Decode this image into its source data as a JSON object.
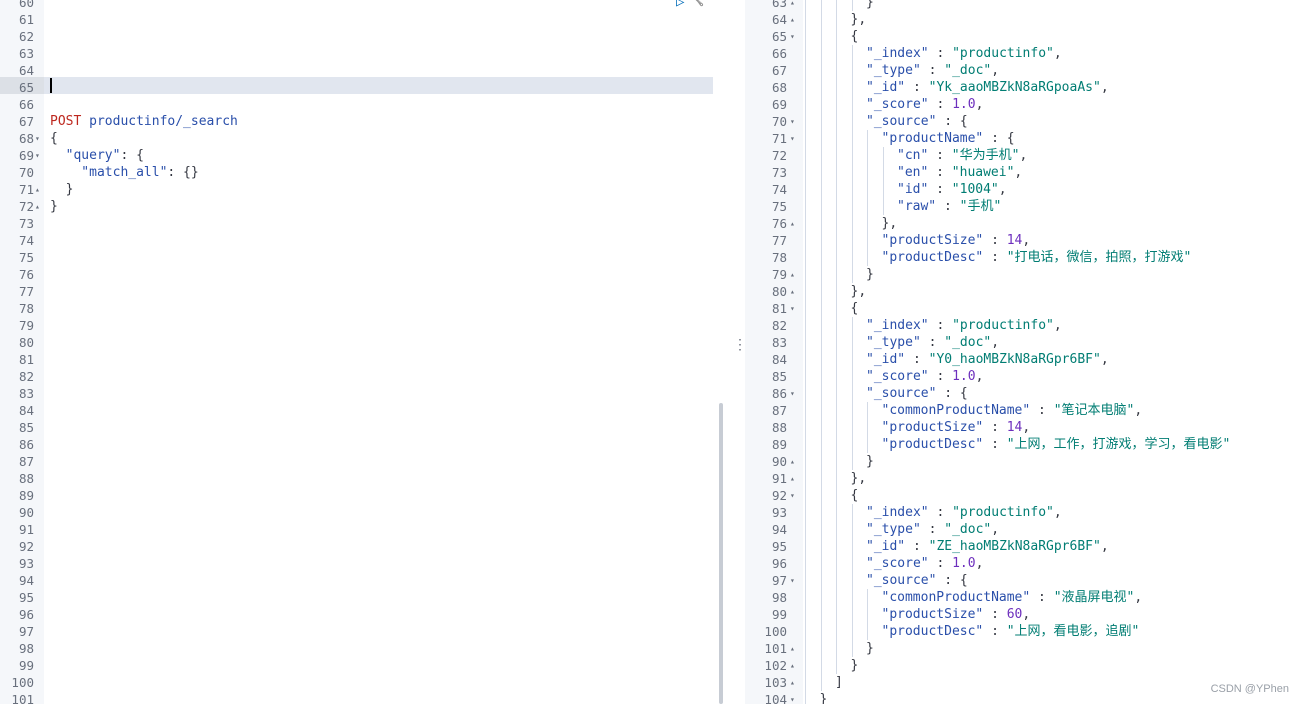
{
  "request": {
    "lines": [
      {
        "n": "60",
        "tokens": []
      },
      {
        "n": "61",
        "tokens": []
      },
      {
        "n": "62",
        "tokens": []
      },
      {
        "n": "63",
        "tokens": []
      },
      {
        "n": "64",
        "tokens": []
      },
      {
        "n": "65",
        "tokens": [],
        "active": true
      },
      {
        "n": "66",
        "tokens": []
      },
      {
        "n": "67",
        "tokens": [
          {
            "t": "POST",
            "c": "method"
          },
          {
            "t": " productinfo/_search",
            "c": "url"
          }
        ]
      },
      {
        "n": "68",
        "fold": "▾",
        "tokens": [
          {
            "t": "{",
            "c": "punc"
          }
        ]
      },
      {
        "n": "69",
        "fold": "▾",
        "tokens": [
          {
            "t": "  \"query\"",
            "c": "key"
          },
          {
            "t": ": {",
            "c": "punc"
          }
        ]
      },
      {
        "n": "70",
        "tokens": [
          {
            "t": "    \"match_all\"",
            "c": "key"
          },
          {
            "t": ": {}",
            "c": "punc"
          }
        ]
      },
      {
        "n": "71",
        "fold": "▴",
        "tokens": [
          {
            "t": "  }",
            "c": "punc"
          }
        ]
      },
      {
        "n": "72",
        "fold": "▴",
        "tokens": [
          {
            "t": "}",
            "c": "punc"
          }
        ]
      },
      {
        "n": "73",
        "tokens": []
      },
      {
        "n": "74",
        "tokens": []
      },
      {
        "n": "75",
        "tokens": []
      },
      {
        "n": "76",
        "tokens": []
      },
      {
        "n": "77",
        "tokens": []
      },
      {
        "n": "78",
        "tokens": []
      },
      {
        "n": "79",
        "tokens": []
      },
      {
        "n": "80",
        "tokens": []
      },
      {
        "n": "81",
        "tokens": []
      },
      {
        "n": "82",
        "tokens": []
      },
      {
        "n": "83",
        "tokens": []
      },
      {
        "n": "84",
        "tokens": []
      },
      {
        "n": "85",
        "tokens": []
      },
      {
        "n": "86",
        "tokens": []
      },
      {
        "n": "87",
        "tokens": []
      },
      {
        "n": "88",
        "tokens": []
      },
      {
        "n": "89",
        "tokens": []
      },
      {
        "n": "90",
        "tokens": []
      },
      {
        "n": "91",
        "tokens": []
      },
      {
        "n": "92",
        "tokens": []
      },
      {
        "n": "93",
        "tokens": []
      },
      {
        "n": "94",
        "tokens": []
      },
      {
        "n": "95",
        "tokens": []
      },
      {
        "n": "96",
        "tokens": []
      },
      {
        "n": "97",
        "tokens": []
      },
      {
        "n": "98",
        "tokens": []
      },
      {
        "n": "99",
        "tokens": []
      },
      {
        "n": "100",
        "tokens": []
      },
      {
        "n": "101",
        "tokens": []
      }
    ]
  },
  "response": {
    "lines": [
      {
        "n": "63",
        "fold": "▴",
        "indent": 4,
        "tokens": [
          {
            "t": "}",
            "c": "punc"
          }
        ]
      },
      {
        "n": "64",
        "fold": "▴",
        "indent": 3,
        "tokens": [
          {
            "t": "},",
            "c": "punc"
          }
        ]
      },
      {
        "n": "65",
        "fold": "▾",
        "indent": 3,
        "tokens": [
          {
            "t": "{",
            "c": "punc"
          }
        ]
      },
      {
        "n": "66",
        "indent": 4,
        "tokens": [
          {
            "t": "\"_index\"",
            "c": "key"
          },
          {
            "t": " : ",
            "c": "punc"
          },
          {
            "t": "\"productinfo\"",
            "c": "str"
          },
          {
            "t": ",",
            "c": "punc"
          }
        ]
      },
      {
        "n": "67",
        "indent": 4,
        "tokens": [
          {
            "t": "\"_type\"",
            "c": "key"
          },
          {
            "t": " : ",
            "c": "punc"
          },
          {
            "t": "\"_doc\"",
            "c": "str"
          },
          {
            "t": ",",
            "c": "punc"
          }
        ]
      },
      {
        "n": "68",
        "indent": 4,
        "tokens": [
          {
            "t": "\"_id\"",
            "c": "key"
          },
          {
            "t": " : ",
            "c": "punc"
          },
          {
            "t": "\"Yk_aaoMBZkN8aRGpoaAs\"",
            "c": "str"
          },
          {
            "t": ",",
            "c": "punc"
          }
        ]
      },
      {
        "n": "69",
        "indent": 4,
        "tokens": [
          {
            "t": "\"_score\"",
            "c": "key"
          },
          {
            "t": " : ",
            "c": "punc"
          },
          {
            "t": "1.0",
            "c": "num"
          },
          {
            "t": ",",
            "c": "punc"
          }
        ]
      },
      {
        "n": "70",
        "fold": "▾",
        "indent": 4,
        "tokens": [
          {
            "t": "\"_source\"",
            "c": "key"
          },
          {
            "t": " : {",
            "c": "punc"
          }
        ]
      },
      {
        "n": "71",
        "fold": "▾",
        "indent": 5,
        "tokens": [
          {
            "t": "\"productName\"",
            "c": "key"
          },
          {
            "t": " : {",
            "c": "punc"
          }
        ]
      },
      {
        "n": "72",
        "indent": 6,
        "tokens": [
          {
            "t": "\"cn\"",
            "c": "key"
          },
          {
            "t": " : ",
            "c": "punc"
          },
          {
            "t": "\"华为手机\"",
            "c": "str"
          },
          {
            "t": ",",
            "c": "punc"
          }
        ]
      },
      {
        "n": "73",
        "indent": 6,
        "tokens": [
          {
            "t": "\"en\"",
            "c": "key"
          },
          {
            "t": " : ",
            "c": "punc"
          },
          {
            "t": "\"huawei\"",
            "c": "str"
          },
          {
            "t": ",",
            "c": "punc"
          }
        ]
      },
      {
        "n": "74",
        "indent": 6,
        "tokens": [
          {
            "t": "\"id\"",
            "c": "key"
          },
          {
            "t": " : ",
            "c": "punc"
          },
          {
            "t": "\"1004\"",
            "c": "str"
          },
          {
            "t": ",",
            "c": "punc"
          }
        ]
      },
      {
        "n": "75",
        "indent": 6,
        "tokens": [
          {
            "t": "\"raw\"",
            "c": "key"
          },
          {
            "t": " : ",
            "c": "punc"
          },
          {
            "t": "\"手机\"",
            "c": "str"
          }
        ]
      },
      {
        "n": "76",
        "fold": "▴",
        "indent": 5,
        "tokens": [
          {
            "t": "},",
            "c": "punc"
          }
        ]
      },
      {
        "n": "77",
        "indent": 5,
        "tokens": [
          {
            "t": "\"productSize\"",
            "c": "key"
          },
          {
            "t": " : ",
            "c": "punc"
          },
          {
            "t": "14",
            "c": "num"
          },
          {
            "t": ",",
            "c": "punc"
          }
        ]
      },
      {
        "n": "78",
        "indent": 5,
        "tokens": [
          {
            "t": "\"productDesc\"",
            "c": "key"
          },
          {
            "t": " : ",
            "c": "punc"
          },
          {
            "t": "\"打电话，微信，拍照，打游戏\"",
            "c": "str"
          }
        ]
      },
      {
        "n": "79",
        "fold": "▴",
        "indent": 4,
        "tokens": [
          {
            "t": "}",
            "c": "punc"
          }
        ]
      },
      {
        "n": "80",
        "fold": "▴",
        "indent": 3,
        "tokens": [
          {
            "t": "},",
            "c": "punc"
          }
        ]
      },
      {
        "n": "81",
        "fold": "▾",
        "indent": 3,
        "tokens": [
          {
            "t": "{",
            "c": "punc"
          }
        ]
      },
      {
        "n": "82",
        "indent": 4,
        "tokens": [
          {
            "t": "\"_index\"",
            "c": "key"
          },
          {
            "t": " : ",
            "c": "punc"
          },
          {
            "t": "\"productinfo\"",
            "c": "str"
          },
          {
            "t": ",",
            "c": "punc"
          }
        ]
      },
      {
        "n": "83",
        "indent": 4,
        "tokens": [
          {
            "t": "\"_type\"",
            "c": "key"
          },
          {
            "t": " : ",
            "c": "punc"
          },
          {
            "t": "\"_doc\"",
            "c": "str"
          },
          {
            "t": ",",
            "c": "punc"
          }
        ]
      },
      {
        "n": "84",
        "indent": 4,
        "tokens": [
          {
            "t": "\"_id\"",
            "c": "key"
          },
          {
            "t": " : ",
            "c": "punc"
          },
          {
            "t": "\"Y0_haoMBZkN8aRGpr6BF\"",
            "c": "str"
          },
          {
            "t": ",",
            "c": "punc"
          }
        ]
      },
      {
        "n": "85",
        "indent": 4,
        "tokens": [
          {
            "t": "\"_score\"",
            "c": "key"
          },
          {
            "t": " : ",
            "c": "punc"
          },
          {
            "t": "1.0",
            "c": "num"
          },
          {
            "t": ",",
            "c": "punc"
          }
        ]
      },
      {
        "n": "86",
        "fold": "▾",
        "indent": 4,
        "tokens": [
          {
            "t": "\"_source\"",
            "c": "key"
          },
          {
            "t": " : {",
            "c": "punc"
          }
        ]
      },
      {
        "n": "87",
        "indent": 5,
        "tokens": [
          {
            "t": "\"commonProductName\"",
            "c": "key"
          },
          {
            "t": " : ",
            "c": "punc"
          },
          {
            "t": "\"笔记本电脑\"",
            "c": "str"
          },
          {
            "t": ",",
            "c": "punc"
          }
        ]
      },
      {
        "n": "88",
        "indent": 5,
        "tokens": [
          {
            "t": "\"productSize\"",
            "c": "key"
          },
          {
            "t": " : ",
            "c": "punc"
          },
          {
            "t": "14",
            "c": "num"
          },
          {
            "t": ",",
            "c": "punc"
          }
        ]
      },
      {
        "n": "89",
        "indent": 5,
        "tokens": [
          {
            "t": "\"productDesc\"",
            "c": "key"
          },
          {
            "t": " : ",
            "c": "punc"
          },
          {
            "t": "\"上网，工作，打游戏，学习，看电影\"",
            "c": "str"
          }
        ]
      },
      {
        "n": "90",
        "fold": "▴",
        "indent": 4,
        "tokens": [
          {
            "t": "}",
            "c": "punc"
          }
        ]
      },
      {
        "n": "91",
        "fold": "▴",
        "indent": 3,
        "tokens": [
          {
            "t": "},",
            "c": "punc"
          }
        ]
      },
      {
        "n": "92",
        "fold": "▾",
        "indent": 3,
        "tokens": [
          {
            "t": "{",
            "c": "punc"
          }
        ]
      },
      {
        "n": "93",
        "indent": 4,
        "tokens": [
          {
            "t": "\"_index\"",
            "c": "key"
          },
          {
            "t": " : ",
            "c": "punc"
          },
          {
            "t": "\"productinfo\"",
            "c": "str"
          },
          {
            "t": ",",
            "c": "punc"
          }
        ]
      },
      {
        "n": "94",
        "indent": 4,
        "tokens": [
          {
            "t": "\"_type\"",
            "c": "key"
          },
          {
            "t": " : ",
            "c": "punc"
          },
          {
            "t": "\"_doc\"",
            "c": "str"
          },
          {
            "t": ",",
            "c": "punc"
          }
        ]
      },
      {
        "n": "95",
        "indent": 4,
        "tokens": [
          {
            "t": "\"_id\"",
            "c": "key"
          },
          {
            "t": " : ",
            "c": "punc"
          },
          {
            "t": "\"ZE_haoMBZkN8aRGpr6BF\"",
            "c": "str"
          },
          {
            "t": ",",
            "c": "punc"
          }
        ]
      },
      {
        "n": "96",
        "indent": 4,
        "tokens": [
          {
            "t": "\"_score\"",
            "c": "key"
          },
          {
            "t": " : ",
            "c": "punc"
          },
          {
            "t": "1.0",
            "c": "num"
          },
          {
            "t": ",",
            "c": "punc"
          }
        ]
      },
      {
        "n": "97",
        "fold": "▾",
        "indent": 4,
        "tokens": [
          {
            "t": "\"_source\"",
            "c": "key"
          },
          {
            "t": " : {",
            "c": "punc"
          }
        ]
      },
      {
        "n": "98",
        "indent": 5,
        "tokens": [
          {
            "t": "\"commonProductName\"",
            "c": "key"
          },
          {
            "t": " : ",
            "c": "punc"
          },
          {
            "t": "\"液晶屏电视\"",
            "c": "str"
          },
          {
            "t": ",",
            "c": "punc"
          }
        ]
      },
      {
        "n": "99",
        "indent": 5,
        "tokens": [
          {
            "t": "\"productSize\"",
            "c": "key"
          },
          {
            "t": " : ",
            "c": "punc"
          },
          {
            "t": "60",
            "c": "num"
          },
          {
            "t": ",",
            "c": "punc"
          }
        ]
      },
      {
        "n": "100",
        "indent": 5,
        "tokens": [
          {
            "t": "\"productDesc\"",
            "c": "key"
          },
          {
            "t": " : ",
            "c": "punc"
          },
          {
            "t": "\"上网，看电影，追剧\"",
            "c": "str"
          }
        ]
      },
      {
        "n": "101",
        "fold": "▴",
        "indent": 4,
        "tokens": [
          {
            "t": "}",
            "c": "punc"
          }
        ]
      },
      {
        "n": "102",
        "fold": "▴",
        "indent": 3,
        "tokens": [
          {
            "t": "}",
            "c": "punc"
          }
        ]
      },
      {
        "n": "103",
        "fold": "▴",
        "indent": 2,
        "tokens": [
          {
            "t": "]",
            "c": "punc"
          }
        ]
      },
      {
        "n": "104",
        "fold": "▾",
        "indent": 1,
        "tokens": [
          {
            "t": "}",
            "c": "punc"
          }
        ]
      }
    ]
  },
  "toolbar": {
    "run_icon": "play-icon",
    "wrench_icon": "wrench-icon",
    "run_glyph": "▷",
    "wrench_glyph": "🔧"
  },
  "resizer_glyph": "⋮",
  "watermark": "CSDN @YPhen"
}
